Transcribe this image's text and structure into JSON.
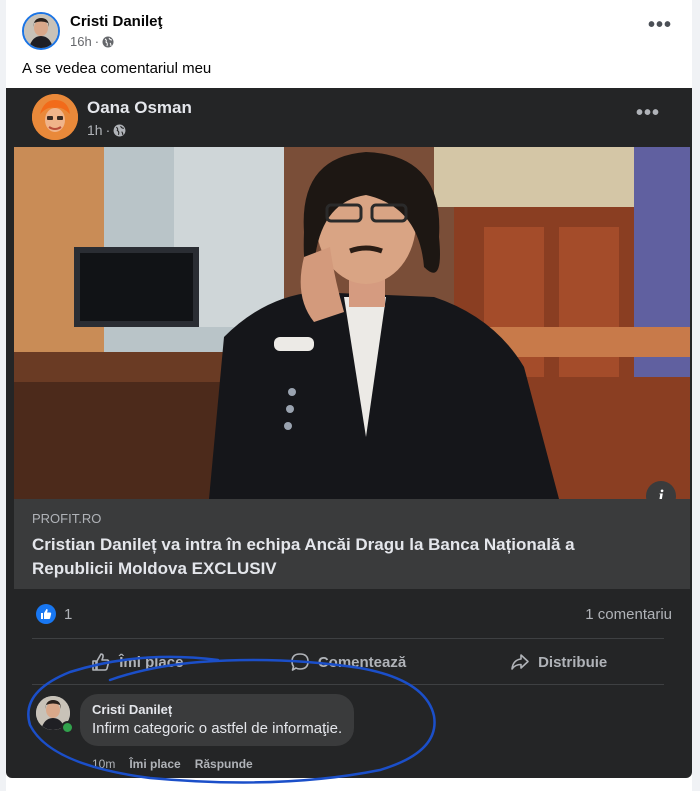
{
  "outer_post": {
    "author": "Cristi Danileţ",
    "time": "16h",
    "text": "A se vedea comentariul meu"
  },
  "shared_post": {
    "author": "Oana Osman",
    "time": "1h",
    "link": {
      "domain": "PROFIT.RO",
      "title": "Cristian Danileț va intra în echipa Ancăi Dragu la Banca Națională a Republicii Moldova EXCLUSIV"
    },
    "reactions": {
      "likes": "1",
      "comments": "1 comentariu"
    },
    "actions": {
      "like": "Îmi place",
      "comment": "Comentează",
      "share": "Distribuie"
    },
    "comment": {
      "author": "Cristi Danileț",
      "text": "Infirm categoric o astfel de informaţie.",
      "time": "10m",
      "like": "Îmi place",
      "reply": "Răspunde"
    }
  },
  "colors": {
    "card_dark": "#242526",
    "link_box": "#3a3b3c",
    "accent_blue": "#1877f2",
    "annotation_blue": "#1b4fc9"
  },
  "icons": [
    "globe-icon",
    "more-icon",
    "info-icon",
    "like-icon",
    "comment-icon",
    "share-icon"
  ]
}
